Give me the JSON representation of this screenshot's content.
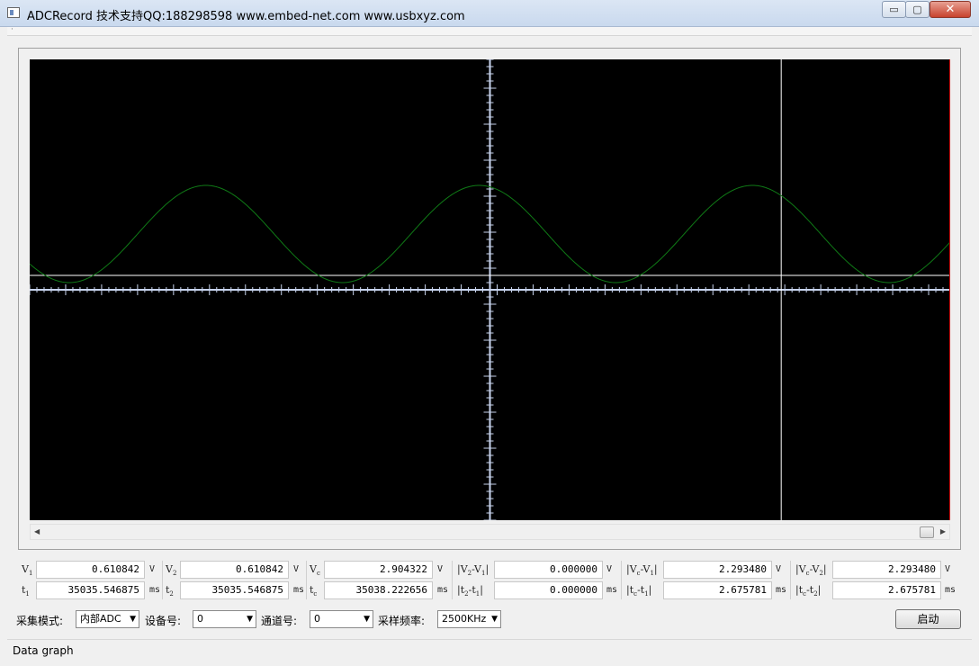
{
  "window": {
    "title": "ADCRecord 技术支持QQ:188298598 www.embed-net.com www.usbxyz.com",
    "min_glyph": "▭",
    "max_glyph": "▢",
    "close_glyph": "✕"
  },
  "menubar": {
    "glyph": "·"
  },
  "scroll": {
    "left_arrow": "◀",
    "right_arrow": "▶"
  },
  "measurements": {
    "row1": [
      {
        "label": "V",
        "sub": "1",
        "value": "0.610842",
        "unit": "V"
      },
      {
        "label": "V",
        "sub": "2",
        "value": "0.610842",
        "unit": "V"
      },
      {
        "label": "V",
        "sub": "c",
        "value": "2.904322",
        "unit": "V"
      },
      {
        "label": "|V",
        "sub": "2",
        "mid": "-V",
        "sub2": "1",
        "end": "|",
        "value": "0.000000",
        "unit": "V"
      },
      {
        "label": "|V",
        "sub": "c",
        "mid": "-V",
        "sub2": "1",
        "end": "|",
        "value": "2.293480",
        "unit": "V"
      },
      {
        "label": "|V",
        "sub": "c",
        "mid": "-V",
        "sub2": "2",
        "end": "|",
        "value": "2.293480",
        "unit": "V"
      }
    ],
    "row2": [
      {
        "label": "t",
        "sub": "1",
        "value": "35035.546875",
        "unit": "ms"
      },
      {
        "label": "t",
        "sub": "2",
        "value": "35035.546875",
        "unit": "ms"
      },
      {
        "label": "t",
        "sub": "c",
        "value": "35038.222656",
        "unit": "ms"
      },
      {
        "label": "|t",
        "sub": "2",
        "mid": "-t",
        "sub2": "1",
        "end": "|",
        "value": "0.000000",
        "unit": "ms"
      },
      {
        "label": "|t",
        "sub": "c",
        "mid": "-t",
        "sub2": "1",
        "end": "|",
        "value": "2.675781",
        "unit": "ms"
      },
      {
        "label": "|t",
        "sub": "c",
        "mid": "-t",
        "sub2": "2",
        "end": "|",
        "value": "2.675781",
        "unit": "ms"
      }
    ]
  },
  "controls": {
    "mode_label": "采集模式:",
    "mode_value": "内部ADC",
    "device_label": "设备号:",
    "device_value": "0",
    "channel_label": "通道号:",
    "channel_value": "0",
    "rate_label": "采样频率:",
    "rate_value": "2500KHz",
    "dropdown_glyph": "▼",
    "start_button": "启动"
  },
  "status": {
    "text": "Data graph"
  },
  "colors": {
    "waveform": "#0f7a16",
    "axis": "#c8d4ee",
    "cursor": "#ffffff",
    "background": "#000000"
  },
  "chart_data": {
    "type": "line",
    "x_range": [
      -12.8,
      12.8
    ],
    "y_range": [
      -6.4,
      6.4
    ],
    "grid": false,
    "series": [
      {
        "values": {
          "period": 7.6,
          "min": 0.2,
          "max": 2.9,
          "x_at_peak": -7.9
        }
      }
    ],
    "cursors": {
      "vertical_x": 8.1,
      "horizontal_y": 0.4
    }
  }
}
